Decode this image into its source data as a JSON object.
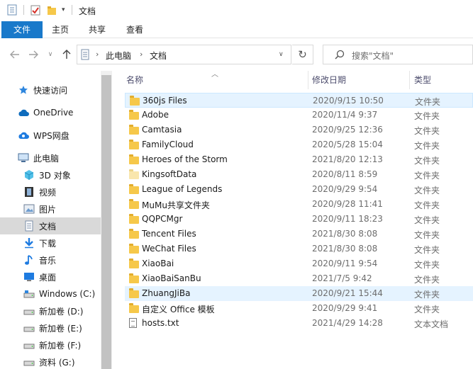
{
  "window": {
    "title": "文档"
  },
  "ribbon": {
    "tabs": [
      "文件",
      "主页",
      "共享",
      "查看"
    ]
  },
  "address": {
    "crumbs": [
      "此电脑",
      "文档"
    ]
  },
  "search": {
    "placeholder": "搜索\"文档\""
  },
  "sidebar": {
    "items": [
      {
        "label": "快速访问",
        "icon": "star-icon"
      },
      {
        "label": "OneDrive",
        "icon": "cloud-icon"
      },
      {
        "label": "WPS网盘",
        "icon": "cloud-icon"
      },
      {
        "label": "此电脑",
        "icon": "computer-icon"
      },
      {
        "label": "3D 对象",
        "icon": "cube-icon"
      },
      {
        "label": "视频",
        "icon": "film-icon"
      },
      {
        "label": "图片",
        "icon": "picture-icon"
      },
      {
        "label": "文档",
        "icon": "document-icon",
        "selected": true
      },
      {
        "label": "下载",
        "icon": "download-icon"
      },
      {
        "label": "音乐",
        "icon": "music-icon"
      },
      {
        "label": "桌面",
        "icon": "desktop-icon"
      },
      {
        "label": "Windows (C:)",
        "icon": "drive-icon"
      },
      {
        "label": "新加卷 (D:)",
        "icon": "drive-icon"
      },
      {
        "label": "新加卷 (E:)",
        "icon": "drive-icon"
      },
      {
        "label": "新加卷 (F:)",
        "icon": "drive-icon"
      },
      {
        "label": "资料 (G:)",
        "icon": "drive-icon"
      }
    ]
  },
  "columns": {
    "name": "名称",
    "date": "修改日期",
    "type": "类型"
  },
  "files": [
    {
      "name": "360js Files",
      "date": "2020/9/15 10:50",
      "type": "文件夹",
      "icon": "folder-icon"
    },
    {
      "name": "Adobe",
      "date": "2020/11/4 9:37",
      "type": "文件夹",
      "icon": "folder-icon"
    },
    {
      "name": "Camtasia",
      "date": "2020/9/25 12:36",
      "type": "文件夹",
      "icon": "folder-icon"
    },
    {
      "name": "FamilyCloud",
      "date": "2020/5/28 15:04",
      "type": "文件夹",
      "icon": "folder-icon"
    },
    {
      "name": "Heroes of the Storm",
      "date": "2021/8/20 12:13",
      "type": "文件夹",
      "icon": "folder-icon"
    },
    {
      "name": "KingsoftData",
      "date": "2020/8/11 8:59",
      "type": "文件夹",
      "icon": "folder-icon"
    },
    {
      "name": "League of Legends",
      "date": "2020/9/29 9:54",
      "type": "文件夹",
      "icon": "folder-icon"
    },
    {
      "name": "MuMu共享文件夹",
      "date": "2020/9/28 11:41",
      "type": "文件夹",
      "icon": "folder-icon"
    },
    {
      "name": "QQPCMgr",
      "date": "2020/9/11 18:23",
      "type": "文件夹",
      "icon": "folder-icon"
    },
    {
      "name": "Tencent Files",
      "date": "2021/8/30 8:08",
      "type": "文件夹",
      "icon": "folder-icon"
    },
    {
      "name": "WeChat Files",
      "date": "2021/8/30 8:08",
      "type": "文件夹",
      "icon": "folder-icon"
    },
    {
      "name": "XiaoBai",
      "date": "2020/9/11 9:54",
      "type": "文件夹",
      "icon": "folder-icon"
    },
    {
      "name": "XiaoBaiSanBu",
      "date": "2021/7/5 9:42",
      "type": "文件夹",
      "icon": "folder-icon"
    },
    {
      "name": "ZhuangJiBa",
      "date": "2020/9/21 15:44",
      "type": "文件夹",
      "icon": "folder-icon"
    },
    {
      "name": "自定义 Office 模板",
      "date": "2020/9/29 9:41",
      "type": "文件夹",
      "icon": "folder-icon"
    },
    {
      "name": "hosts.txt",
      "date": "2021/4/29 14:28",
      "type": "文本文档",
      "icon": "text-file-icon"
    }
  ],
  "colors": {
    "accent": "#1979ca",
    "folder": "#f6c84a",
    "selection": "#e5f3ff"
  }
}
